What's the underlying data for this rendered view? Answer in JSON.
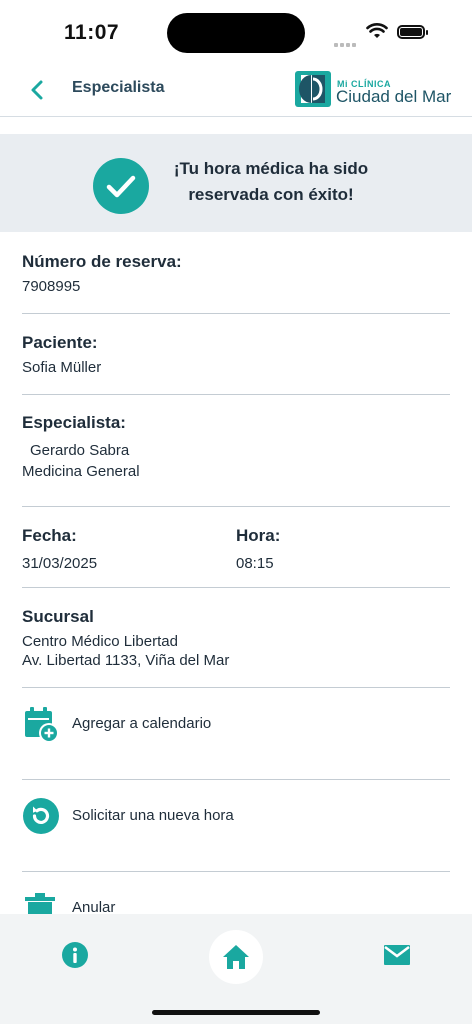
{
  "status_bar": {
    "time": "11:07"
  },
  "nav": {
    "title": "Especialista",
    "logo_small": "Mi CLÍNICA",
    "logo_big": "Ciudad del Mar"
  },
  "banner": {
    "line1": "¡Tu hora médica ha sido",
    "line2": "reservada con éxito!"
  },
  "reserva": {
    "label": "Número de reserva:",
    "value": "7908995"
  },
  "paciente": {
    "label": "Paciente:",
    "value": "Sofia Müller"
  },
  "especialista": {
    "label": "Especialista:",
    "name": "Gerardo Sabra",
    "specialty": "Medicina General"
  },
  "fecha": {
    "label": "Fecha:",
    "value": "31/03/2025"
  },
  "hora": {
    "label": "Hora:",
    "value": "08:15"
  },
  "sucursal": {
    "label": "Sucursal",
    "name": "Centro Médico Libertad",
    "address": "Av. Libertad 1133, Viña del Mar"
  },
  "actions": {
    "calendar": "Agregar a calendario",
    "new_hour": "Solicitar una nueva hora",
    "cancel": "Anular"
  },
  "colors": {
    "accent": "#1aa8a0",
    "text": "#1f2d3a",
    "banner_bg": "#e9edf1",
    "tab_bg": "#f2f4f5"
  },
  "icons": {
    "back": "chevron-left-icon",
    "check": "check-icon",
    "calendar": "calendar-plus-icon",
    "new_hour": "refresh-icon",
    "cancel": "trash-icon",
    "info": "info-icon",
    "home": "home-icon",
    "mail": "mail-icon"
  }
}
